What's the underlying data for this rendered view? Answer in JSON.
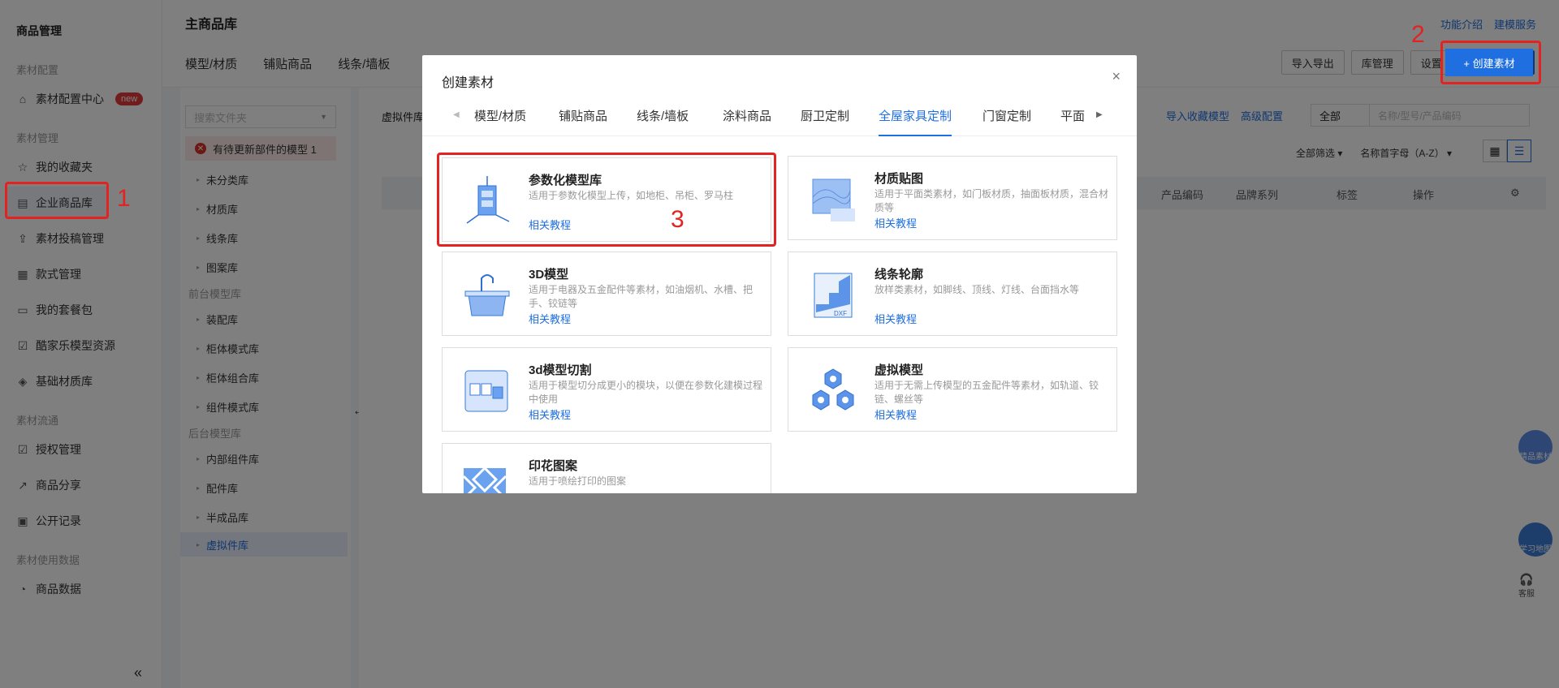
{
  "sidebar": {
    "title": "商品管理",
    "groups": {
      "config": "素材配置",
      "manage": "素材管理",
      "flow": "素材流通",
      "usage": "素材使用数据"
    },
    "items": [
      {
        "label": "素材配置中心",
        "badge": "new"
      },
      {
        "label": "我的收藏夹"
      },
      {
        "label": "企业商品库"
      },
      {
        "label": "素材投稿管理"
      },
      {
        "label": "款式管理"
      },
      {
        "label": "我的套餐包"
      },
      {
        "label": "酷家乐模型资源"
      },
      {
        "label": "基础材质库"
      },
      {
        "label": "授权管理"
      },
      {
        "label": "商品分享"
      },
      {
        "label": "公开记录"
      },
      {
        "label": "商品数据"
      }
    ],
    "collapse": "«"
  },
  "header": {
    "title": "主商品库",
    "tabs": [
      "模型/材质",
      "铺贴商品",
      "线条/墙板"
    ],
    "links": [
      "功能介绍",
      "建模服务"
    ],
    "buttons": {
      "import_export": "导入导出",
      "library": "库管理",
      "settings": "设置",
      "create": "+ 创建素材"
    }
  },
  "folders": {
    "search_placeholder": "搜索文件夹",
    "warning": "有待更新部件的模型 1",
    "items": [
      "未分类库",
      "材质库",
      "线条库",
      "图案库"
    ],
    "group_front": "前台模型库",
    "front_items": [
      "装配库",
      "柜体模式库",
      "柜体组合库",
      "组件模式库"
    ],
    "group_back": "后台模型库",
    "back_items": [
      "内部组件库",
      "配件库",
      "半成品库",
      "虚拟件库"
    ]
  },
  "content": {
    "crumb": "虚拟件库",
    "links": [
      "导入收藏模型",
      "高级配置"
    ],
    "filter_select": "全部",
    "filter_placeholder": "名称/型号/产品编码",
    "sort": [
      "全部筛选 ▾",
      "名称首字母（A-Z） ▾"
    ],
    "columns": [
      "产品编码",
      "品牌系列",
      "标签",
      "操作"
    ]
  },
  "dialog": {
    "title": "创建素材",
    "close": "×",
    "tabs": [
      "模型/材质",
      "铺贴商品",
      "线条/墙板",
      "涂料商品",
      "厨卫定制",
      "全屋家具定制",
      "门窗定制",
      "平面"
    ],
    "active_tab": "全屋家具定制",
    "cards": [
      {
        "title": "参数化模型库",
        "desc": "适用于参数化模型上传，如地柜、吊柜、罗马柱",
        "link": "相关教程"
      },
      {
        "title": "材质贴图",
        "desc": "适用于平面类素材，如门板材质，抽面板材质，混合材质等",
        "link": "相关教程"
      },
      {
        "title": "3D模型",
        "desc": "适用于电器及五金配件等素材，如油烟机、水槽、把手、铰链等",
        "link": "相关教程"
      },
      {
        "title": "线条轮廓",
        "desc": "放样类素材，如脚线、顶线、灯线、台面挡水等",
        "link": "相关教程"
      },
      {
        "title": "3d模型切割",
        "desc": "适用于模型切分成更小的模块，以便在参数化建模过程中使用",
        "link": "相关教程"
      },
      {
        "title": "虚拟模型",
        "desc": "适用于无需上传模型的五金配件等素材，如轨道、铰链、螺丝等",
        "link": "相关教程"
      },
      {
        "title": "印花图案",
        "desc": "适用于喷绘打印的图案",
        "link": ""
      }
    ]
  },
  "annotations": [
    "1",
    "2",
    "3"
  ],
  "floating": {
    "w1": "精品素材",
    "w2": "学习地图",
    "w3": "客服"
  },
  "colors": {
    "accent": "#1f6fe0",
    "annotation": "#e32222"
  }
}
